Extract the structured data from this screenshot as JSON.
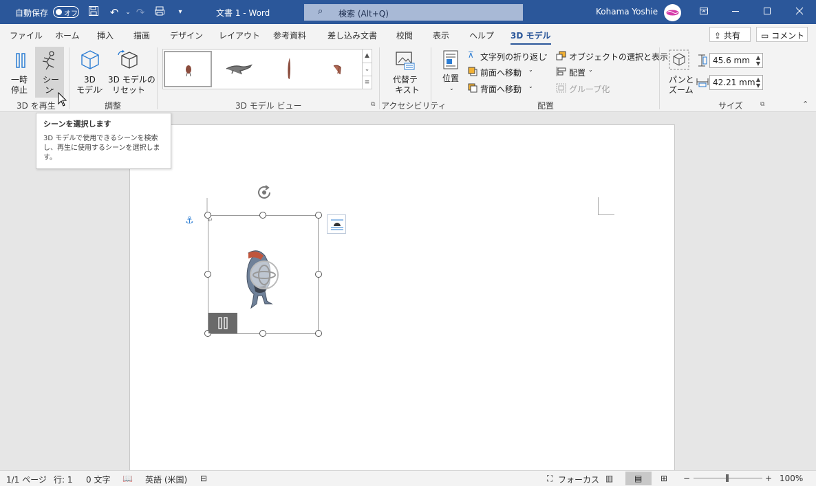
{
  "title_bar": {
    "autosave_label": "自動保存",
    "autosave_state": "オフ",
    "doc_title": "文書 1  -  Word",
    "search_placeholder": "検索 (Alt+Q)",
    "user_name": "Kohama Yoshie"
  },
  "tabs": [
    "ファイル",
    "ホーム",
    "挿入",
    "描画",
    "デザイン",
    "レイアウト",
    "参考資料",
    "差し込み文書",
    "校閲",
    "表示",
    "ヘルプ",
    "3D モデル"
  ],
  "active_tab": "3D モデル",
  "header_buttons": {
    "share": "共有",
    "comment": "コメント"
  },
  "ribbon": {
    "pause_label_1": "一時",
    "pause_label_2": "停止",
    "scene_label_1": "シー",
    "scene_label_2": "ン",
    "group_play": "3D を再生",
    "model_label_1": "3D",
    "model_label_2": "モデル",
    "reset_label_1": "3D モデルの",
    "reset_label_2": "リセット",
    "group_adjust": "調整",
    "group_view": "3D モデル ビュー",
    "alt_text_1": "代替テ",
    "alt_text_2": "キスト",
    "group_access": "アクセシビリティ",
    "position_label": "位置",
    "wrap_text": "文字列の折り返し",
    "bring_forward": "前面へ移動",
    "send_backward": "背面へ移動",
    "selection_pane": "オブジェクトの選択と表示",
    "align": "配置",
    "group_objects": "グループ化",
    "group_arrange": "配置",
    "pan_zoom_1": "パンと",
    "pan_zoom_2": "ズーム",
    "height_value": "45.6 mm",
    "width_value": "42.21 mm",
    "group_size": "サイズ"
  },
  "tooltip": {
    "title": "シーンを選択します",
    "body": "3D モデルで使用できるシーンを検索し、再生に使用するシーンを選択します。"
  },
  "status_bar": {
    "page": "1/1 ページ",
    "line": "行: 1",
    "chars": "0 文字",
    "language": "英語 (米国)",
    "focus": "フォーカス",
    "zoom": "100%"
  },
  "colors": {
    "accent": "#2b579a"
  }
}
